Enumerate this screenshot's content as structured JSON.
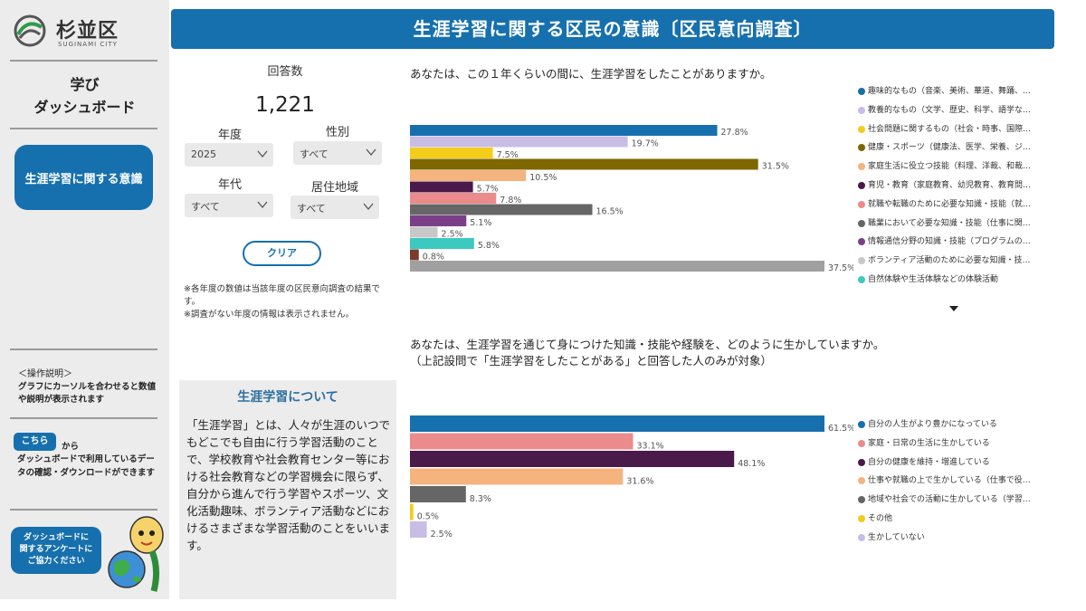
{
  "logo": {
    "name": "杉並区",
    "sub": "SUGINAMI CITY"
  },
  "sidebar": {
    "title_line1": "学び",
    "title_line2": "ダッシュボード",
    "nav_button": "生涯学習に関する意識",
    "operation_title": "＜操作説明＞",
    "operation_text": "グラフにカーソルを合わせると数値や説明が表示されます",
    "kochira_button": "こちら",
    "kochira_suffix": "から",
    "kochira_text": "ダッシュボードで利用しているデータの確認・ダウンロードができます",
    "survey_line1": "ダッシュボードに",
    "survey_line2": "関するアンケートに",
    "survey_line3": "ご協力ください"
  },
  "header": {
    "title": "生涯学習に関する区民の意識〔区民意向調査〕"
  },
  "filters": {
    "count_label": "回答数",
    "count_value": "1,221",
    "year_label": "年度",
    "year_value": "2025",
    "gender_label": "性別",
    "gender_value": "すべて",
    "age_label": "年代",
    "age_value": "すべて",
    "area_label": "居住地域",
    "area_value": "すべて",
    "clear_button": "クリア",
    "note_line1": "※各年度の数値は当該年度の区民意向調査の結果です。",
    "note_line2": "※調査がない年度の情報は表示されません。"
  },
  "about": {
    "title": "生涯学習について",
    "text": "「生涯学習」とは、人々が生涯のいつでもどこでも自由に行う学習活動のことで、学校教育や社会教育センター等における社会教育などの学習機会に限らず、自分から進んで行う学習やスポーツ、文化活動趣味、ボランティア活動などにおけるさまざまな学習活動のことをいいます。"
  },
  "chart_data": [
    {
      "type": "bar",
      "orientation": "horizontal",
      "title": "あなたは、この１年くらいの間に、生涯学習をしたことがありますか。",
      "legend_position": "right",
      "series": [
        {
          "name": "趣味的なもの（音楽、美術、華道、舞踊、…",
          "value": 27.8,
          "label": "27.8%",
          "color": "#1670ad"
        },
        {
          "name": "教養的なもの（文学、歴史、科学、語学な…",
          "value": 19.7,
          "label": "19.7%",
          "color": "#c9bde6"
        },
        {
          "name": "社会問題に関するもの（社会・時事、国際…",
          "value": 7.5,
          "label": "7.5%",
          "color": "#f4cc1b"
        },
        {
          "name": "健康・スポーツ（健康法、医学、栄養、ジ…",
          "value": 31.5,
          "label": "31.5%",
          "color": "#7f6700"
        },
        {
          "name": "家庭生活に役立つ技能（料理、洋裁、和裁…",
          "value": 10.5,
          "label": "10.5%",
          "color": "#f5b37e"
        },
        {
          "name": "育児・教育（家庭教育、幼児教育、教育問…",
          "value": 5.7,
          "label": "5.7%",
          "color": "#4a1a4a"
        },
        {
          "name": "就職や転職のために必要な知識・技能（就…",
          "value": 7.8,
          "label": "7.8%",
          "color": "#ec8b8b"
        },
        {
          "name": "職業において必要な知識・技能（仕事に関…",
          "value": 16.5,
          "label": "16.5%",
          "color": "#666666"
        },
        {
          "name": "情報通信分野の知識・技能（プログラムの…",
          "value": 5.1,
          "label": "5.1%",
          "color": "#7b3f8a"
        },
        {
          "name": "ボランティア活動のために必要な知識・技…",
          "value": 2.5,
          "label": "2.5%",
          "color": "#c8c8c8"
        },
        {
          "name": "自然体験や生活体験などの体験活動",
          "value": 5.8,
          "label": "5.8%",
          "color": "#3cc9c0"
        },
        {
          "name": "",
          "value": 0.8,
          "label": "0.8%",
          "color": "#7b3a2a"
        },
        {
          "name": "",
          "value": 37.5,
          "label": "37.5%",
          "color": "#a0a0a0"
        }
      ],
      "xlim": [
        0,
        37.5
      ]
    },
    {
      "type": "bar",
      "orientation": "horizontal",
      "title": "あなたは、生涯学習を通じて身につけた知識・技能や経験を、どのように生かしていますか。",
      "subtitle": "（上記設問で「生涯学習をしたことがある」と回答した人のみが対象）",
      "legend_position": "right",
      "series": [
        {
          "name": "自分の人生がより豊かになっている",
          "value": 61.5,
          "label": "61.5%",
          "color": "#1670ad"
        },
        {
          "name": "家庭・日常の生活に生かしている",
          "value": 33.1,
          "label": "33.1%",
          "color": "#ec8b8b"
        },
        {
          "name": "自分の健康を維持・増進している",
          "value": 48.1,
          "label": "48.1%",
          "color": "#4a1a4a"
        },
        {
          "name": "仕事や就職の上で生かしている（仕事で役…",
          "value": 31.6,
          "label": "31.6%",
          "color": "#f5b37e"
        },
        {
          "name": "地域や社会での活動に生かしている（学習…",
          "value": 8.3,
          "label": "8.3%",
          "color": "#666666"
        },
        {
          "name": "その他",
          "value": 0.5,
          "label": "0.5%",
          "color": "#f4cc1b"
        },
        {
          "name": "生かしていない",
          "value": 2.5,
          "label": "2.5%",
          "color": "#c9bde6"
        }
      ],
      "xlim": [
        0,
        61.5
      ]
    }
  ]
}
